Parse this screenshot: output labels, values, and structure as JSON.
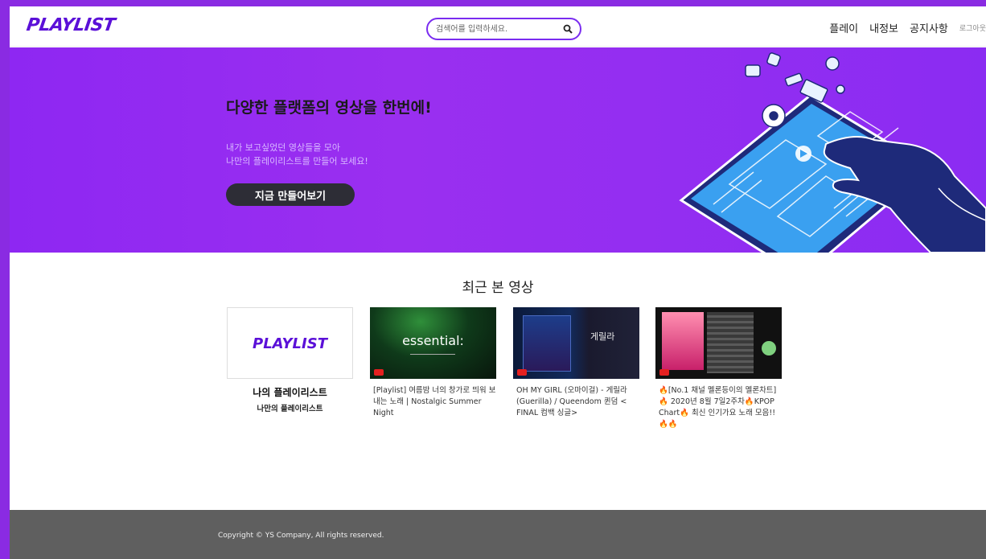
{
  "header": {
    "logo": "PLAYLIST",
    "search_placeholder": "검색어를 입력하세요.",
    "nav": [
      "플레이",
      "내정보",
      "공지사항"
    ],
    "logout": "로그아웃"
  },
  "hero": {
    "title": "다양한 플랫폼의 영상을 한번에!",
    "sub1": "내가 보고싶었던 영상들을 모아",
    "sub2": "나만의 플레이리스트를 만들어 보세요!",
    "cta": "지금 만들어보기"
  },
  "recent": {
    "title": "최근 본 영상",
    "my_playlist": {
      "logo": "PLAYLIST",
      "title": "나의 플레이리스트",
      "subtitle": "나만의 플레이리스트"
    },
    "videos": [
      {
        "thumb_text": "essential:",
        "caption": "[Playlist] 여름밤 너의 창가로 띄워 보내는 노래 | Nostalgic Summer Night"
      },
      {
        "thumb_text": "게릴라",
        "caption": "OH MY GIRL (오마이걸) - 게릴라 (Guerilla) / Queendom 퀸덤 < FINAL 컴백 싱글>"
      },
      {
        "thumb_text": "",
        "caption": "🔥[No.1 채널 멜론등이의 멜론차트]🔥 2020년 8월 7일2주차🔥KPOP Chart🔥 최신 인기가요 노래 모음!!🔥🔥"
      }
    ]
  },
  "footer": {
    "copyright": "Copyright © YS Company, All rights reserved."
  },
  "colors": {
    "accent": "#8a2be2",
    "logo": "#5b10d8",
    "cta_bg": "#2d2d36",
    "footer_bg": "#5f5f5f"
  }
}
